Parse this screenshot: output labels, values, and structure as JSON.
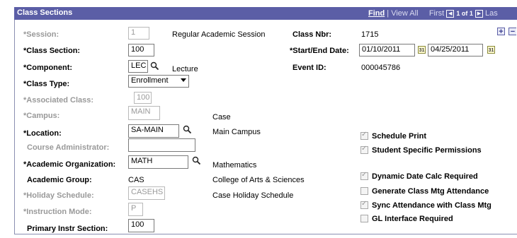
{
  "header": {
    "title": "Class Sections",
    "find": "Find",
    "sep": "|",
    "view_all": "View All",
    "first": "First",
    "count": "1 of 1",
    "last": "Las"
  },
  "fields": {
    "session_label": "*Session:",
    "session_value": "1",
    "session_desc": "Regular Academic Session",
    "class_nbr_label": "Class Nbr:",
    "class_nbr_value": "1715",
    "class_section_label": "*Class Section:",
    "class_section_value": "100",
    "start_end_label": "*Start/End Date:",
    "start_date": "01/10/2011",
    "end_date": "04/25/2011",
    "component_label": "*Component:",
    "component_value": "LEC",
    "component_desc": "Lecture",
    "event_id_label": "Event ID:",
    "event_id_value": "000045786",
    "class_type_label": "*Class Type:",
    "class_type_value": "Enrollment",
    "assoc_class_label": "*Associated Class:",
    "assoc_class_value": "100",
    "campus_label": "*Campus:",
    "campus_value": "MAIN",
    "campus_desc": "Case",
    "location_label": "*Location:",
    "location_value": "SA-MAIN",
    "location_desc": "Main Campus",
    "course_admin_label": "Course Administrator:",
    "course_admin_value": "",
    "acad_org_label": "*Academic Organization:",
    "acad_org_value": "MATH",
    "acad_org_desc": "Mathematics",
    "acad_group_label": "Academic Group:",
    "acad_group_value": "CAS",
    "acad_group_desc": "College of Arts & Sciences",
    "holiday_label": "*Holiday Schedule:",
    "holiday_value": "CASEHS",
    "holiday_desc": "Case Holiday Schedule",
    "instr_mode_label": "*Instruction Mode:",
    "instr_mode_value": "P",
    "primary_instr_label": "Primary Instr Section:",
    "primary_instr_value": "100"
  },
  "checkboxes": {
    "schedule_print": "Schedule Print",
    "student_specific": "Student Specific Permissions",
    "dynamic_date": "Dynamic Date Calc Required",
    "generate_attendance": "Generate Class Mtg Attendance",
    "sync_attendance": "Sync Attendance with Class Mtg",
    "gl_interface": "GL Interface Required"
  },
  "colors": {
    "header_bg": "#5b5ea6",
    "border": "#8b8fb1"
  },
  "icons": {
    "lookup": "magnifier-icon",
    "calendar": "calendar-icon",
    "add": "plus-icon",
    "remove": "minus-icon"
  }
}
